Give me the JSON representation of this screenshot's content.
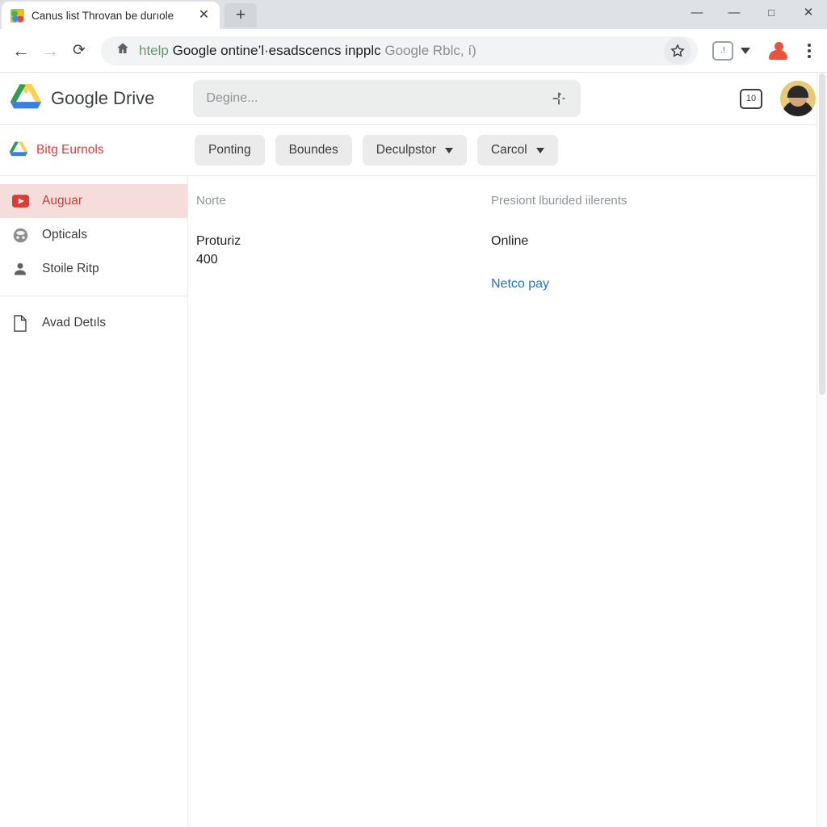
{
  "browser": {
    "tab": {
      "title": "Canus list Throvan be durıole",
      "favicon": "colorful-app-favicon",
      "close_icon": "✕"
    },
    "new_tab_icon": "+",
    "window_controls": [
      {
        "name": "minimize",
        "glyph": "—"
      },
      {
        "name": "restore",
        "glyph": "—"
      },
      {
        "name": "maximize",
        "glyph": "□"
      },
      {
        "name": "close",
        "glyph": "✕"
      }
    ],
    "nav": {
      "back_icon": "←",
      "forward_icon": "→",
      "reload_icon": "⟳",
      "site_icon": "home-icon"
    },
    "omnibox": {
      "scheme": "htelp",
      "url_main": "Google ontine’l·esadscencs inpplc",
      "url_faint": "Google Rblc, í)",
      "star_icon": "☆",
      "extension_badge": ".!",
      "profile_icon": "profile-avatar",
      "menu_icon": "kebab-menu"
    }
  },
  "drive": {
    "app_name": "Google Drive",
    "logo": "google-drive-logo",
    "search": {
      "placeholder": "Degine...",
      "tune_icon": "tune-icon"
    },
    "header_right": {
      "count_badge": "10",
      "avatar": "user-avatar"
    }
  },
  "toolbar": {
    "breadcrumb": {
      "icon": "drive-folder-icon",
      "label": "Bitg Eurnols",
      "color": "#d93b3b"
    },
    "buttons": [
      {
        "label": "Ponting",
        "has_caret": false
      },
      {
        "label": "Boundes",
        "has_caret": false
      },
      {
        "label": "Deculpstor",
        "has_caret": true
      },
      {
        "label": "Carcol",
        "has_caret": true
      }
    ]
  },
  "sidebar": {
    "items": [
      {
        "label": "Auguar",
        "icon": "play-video-icon",
        "active": true
      },
      {
        "label": "Opticals",
        "icon": "globe-icon",
        "active": false
      },
      {
        "label": "Stoile Ritp",
        "icon": "person-icon",
        "active": false
      },
      {
        "label": "Avad Detıls",
        "icon": "document-icon",
        "active": false
      }
    ],
    "active_bg": "#f7dcdc",
    "active_fg": "#b8453f"
  },
  "content": {
    "left_column": {
      "header": "Norte",
      "line1": "Proturiz",
      "line2": "400"
    },
    "right_column": {
      "header": "Presiont lburided iilerents",
      "value": "Online",
      "link": "Netco pay",
      "link_color": "#1a73c8"
    }
  }
}
